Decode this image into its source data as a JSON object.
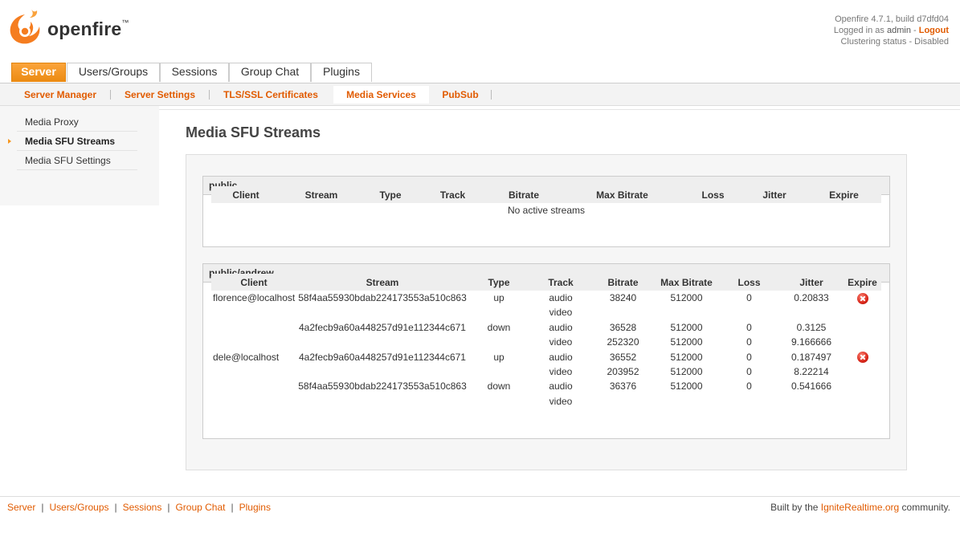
{
  "brand": {
    "name": "openfire",
    "tm": "™"
  },
  "header": {
    "version": "Openfire 4.7.1, build d7dfd04",
    "logged_in_prefix": "Logged in as",
    "user": "admin",
    "logout_sep": " - ",
    "logout": "Logout",
    "clustering": "Clustering status - Disabled"
  },
  "main_tabs": [
    "Server",
    "Users/Groups",
    "Sessions",
    "Group Chat",
    "Plugins"
  ],
  "sub_tabs": [
    "Server Manager",
    "Server Settings",
    "TLS/SSL Certificates",
    "Media Services",
    "PubSub"
  ],
  "sidebar": [
    "Media Proxy",
    "Media SFU Streams",
    "Media SFU Settings"
  ],
  "page_title": "Media SFU Streams",
  "columns": [
    "Client",
    "Stream",
    "Type",
    "Track",
    "Bitrate",
    "Max Bitrate",
    "Loss",
    "Jitter",
    "Expire"
  ],
  "groups": [
    {
      "name": "public",
      "empty_text": "No active streams"
    },
    {
      "name": "public/andrew",
      "rows": [
        {
          "client": "florence@localhost",
          "stream": "58f4aa55930bdab224173553a510c863",
          "type": "up",
          "track": "audio",
          "bitrate": "38240",
          "max_bitrate": "512000",
          "loss": "0",
          "jitter": "0.20833",
          "expire": true
        },
        {
          "client": "",
          "stream": "",
          "type": "",
          "track": "video",
          "bitrate": "",
          "max_bitrate": "",
          "loss": "",
          "jitter": "",
          "expire": false
        },
        {
          "client": "",
          "stream": "4a2fecb9a60a448257d91e112344c671",
          "type": "down",
          "track": "audio",
          "bitrate": "36528",
          "max_bitrate": "512000",
          "loss": "0",
          "jitter": "0.3125",
          "expire": false
        },
        {
          "client": "",
          "stream": "",
          "type": "",
          "track": "video",
          "bitrate": "252320",
          "max_bitrate": "512000",
          "loss": "0",
          "jitter": "9.166666",
          "expire": false
        },
        {
          "client": "dele@localhost",
          "stream": "4a2fecb9a60a448257d91e112344c671",
          "type": "up",
          "track": "audio",
          "bitrate": "36552",
          "max_bitrate": "512000",
          "loss": "0",
          "jitter": "0.187497",
          "expire": true
        },
        {
          "client": "",
          "stream": "",
          "type": "",
          "track": "video",
          "bitrate": "203952",
          "max_bitrate": "512000",
          "loss": "0",
          "jitter": "8.22214",
          "expire": false
        },
        {
          "client": "",
          "stream": "58f4aa55930bdab224173553a510c863",
          "type": "down",
          "track": "audio",
          "bitrate": "36376",
          "max_bitrate": "512000",
          "loss": "0",
          "jitter": "0.541666",
          "expire": false
        },
        {
          "client": "",
          "stream": "",
          "type": "",
          "track": "video",
          "bitrate": "",
          "max_bitrate": "",
          "loss": "",
          "jitter": "",
          "expire": false
        }
      ]
    }
  ],
  "footer": {
    "links": [
      "Server",
      "Users/Groups",
      "Sessions",
      "Group Chat",
      "Plugins"
    ],
    "credit_prefix": "Built by the",
    "credit_link": "IgniteRealtime.org",
    "credit_suffix": "community."
  },
  "colors": {
    "accent": "#f7961d",
    "link": "#e15b00",
    "expire_icon": "#d8261a"
  }
}
